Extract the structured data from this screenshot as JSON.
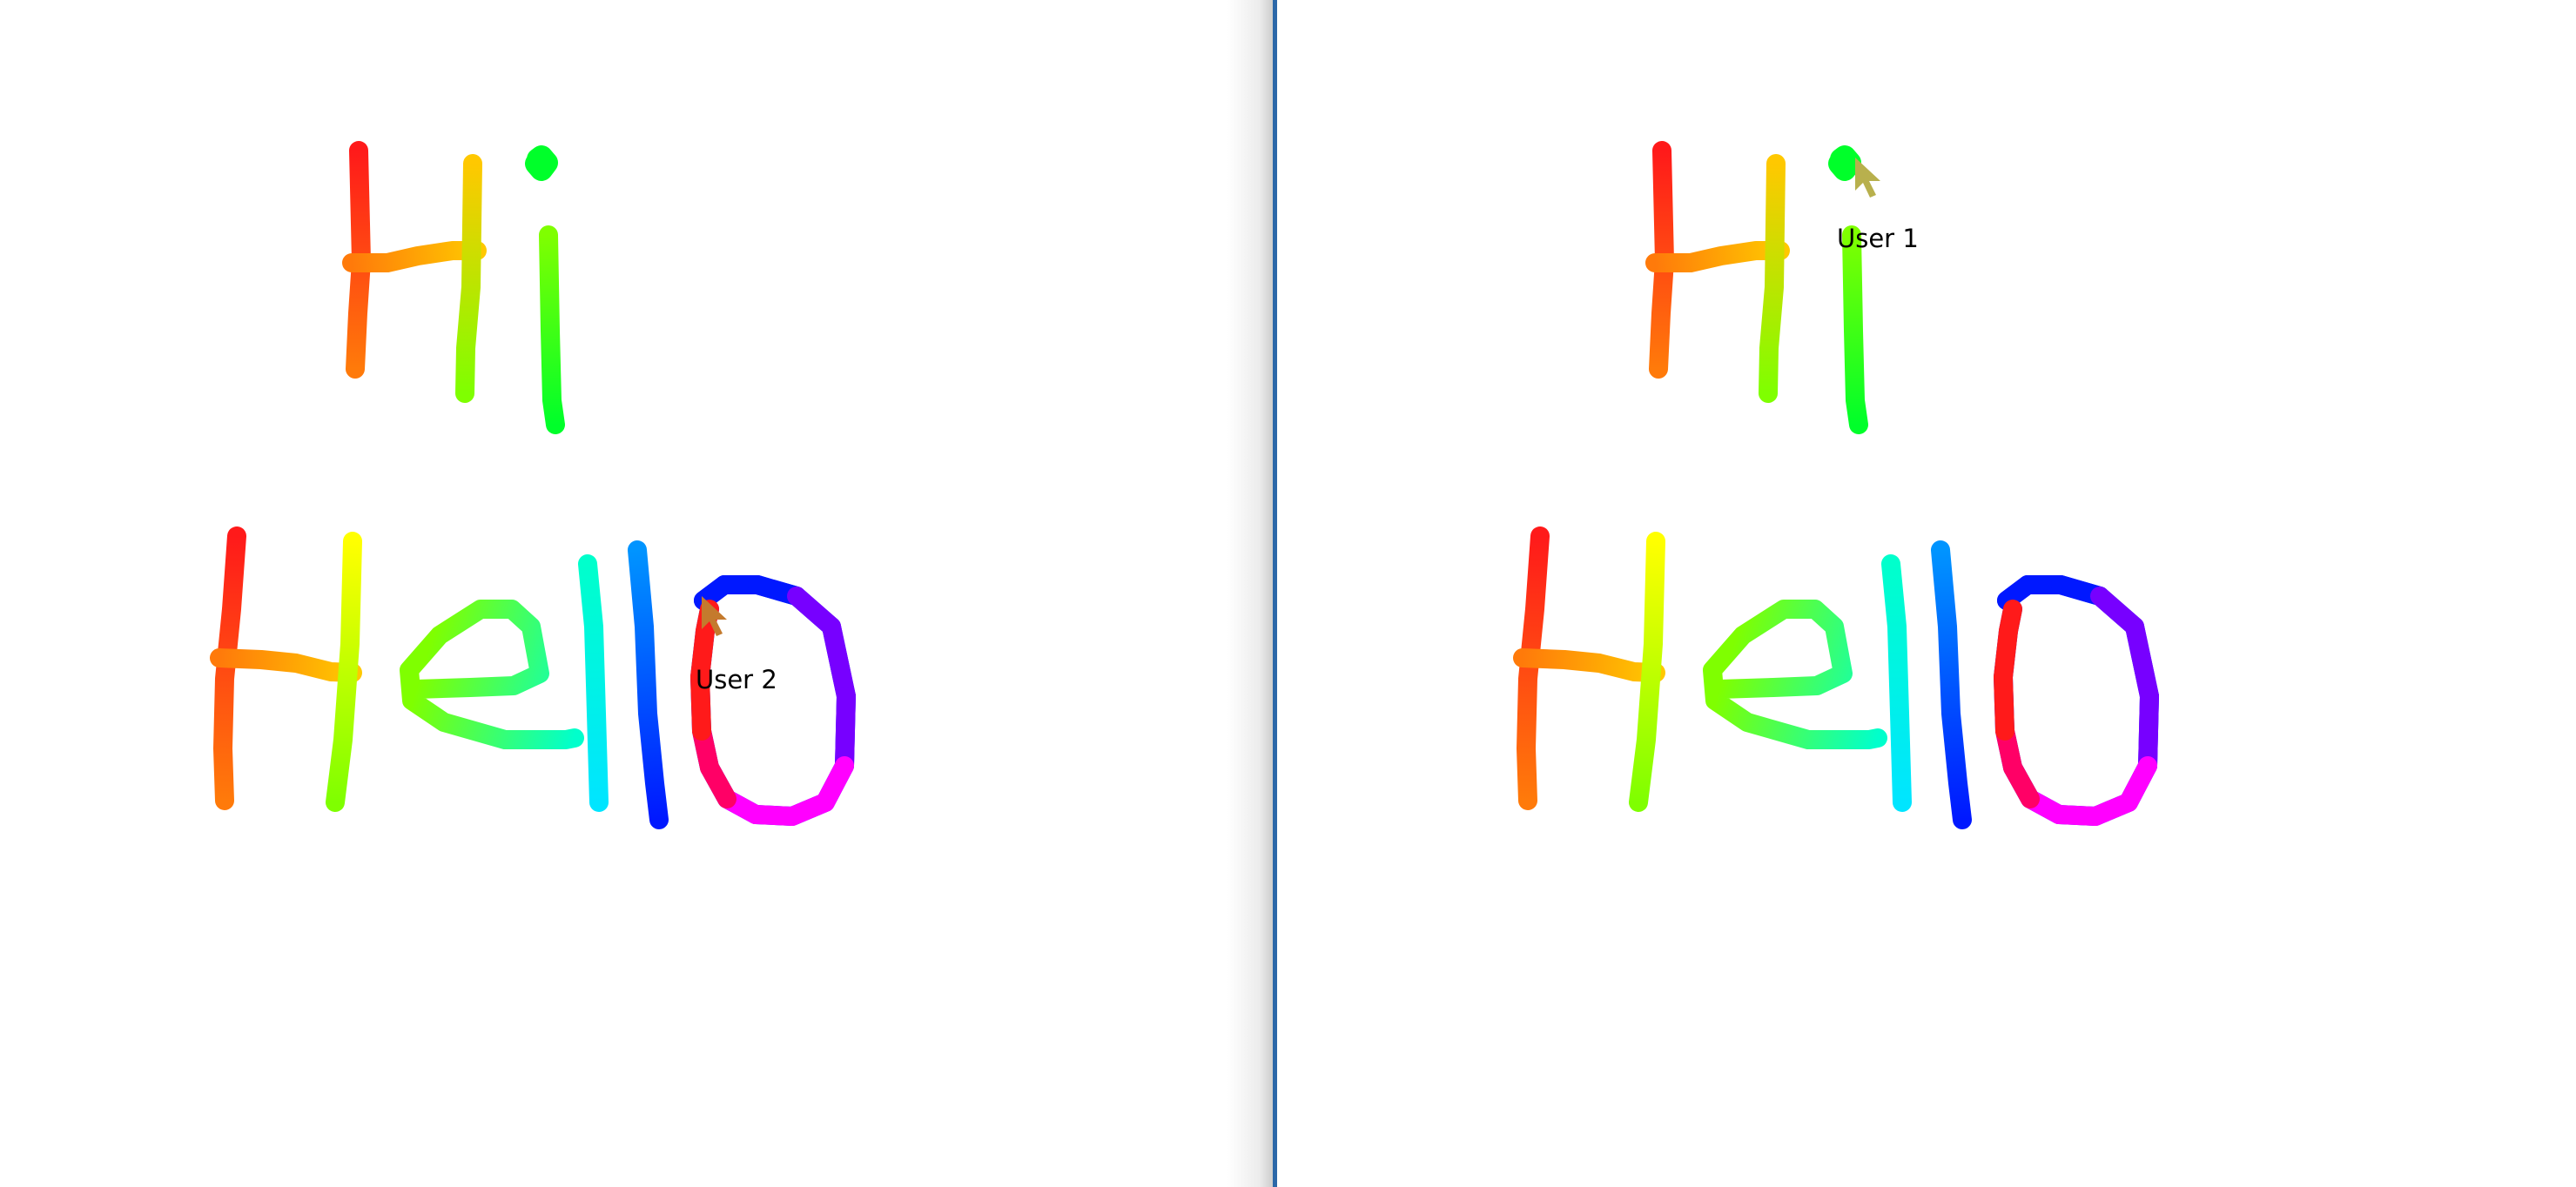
{
  "panes": [
    {
      "id": "left",
      "remote_cursor": {
        "user_label": "User 2",
        "color": "#c47a2d"
      }
    },
    {
      "id": "right",
      "remote_cursor": {
        "user_label": "User 1",
        "color": "#b8b04d"
      }
    }
  ],
  "divider_color": "#2b67a8",
  "stroke_colors": [
    "#ff1a1a",
    "#ff7a0a",
    "#ffc800",
    "#ffff00",
    "#7fff00",
    "#00ff2a",
    "#00ffcc",
    "#00e5ff",
    "#0094ff",
    "#0018ff",
    "#7700ff",
    "#ff00ff",
    "#ff0066"
  ]
}
